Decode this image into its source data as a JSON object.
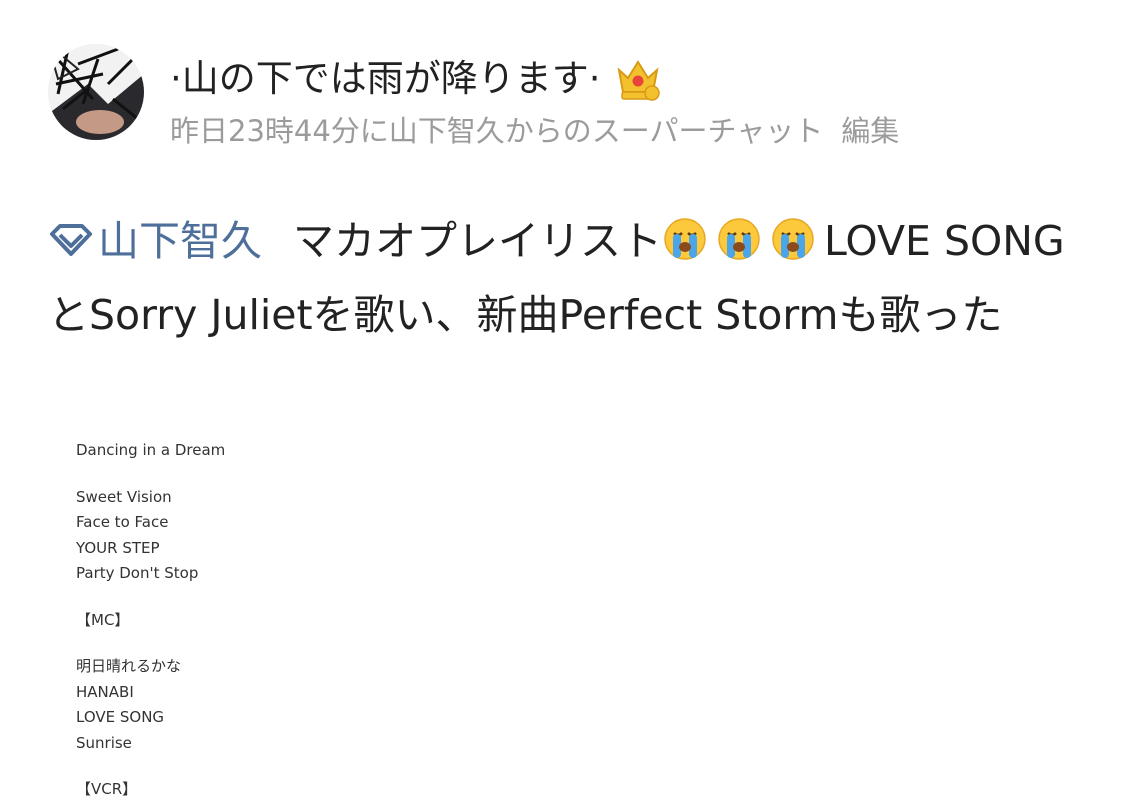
{
  "post": {
    "username": "·山の下では雨が降ります·",
    "meta_text": "昨日23時44分に山下智久からのスーパーチャット",
    "edit_label": "編集",
    "tag_label": "山下智久",
    "body_part1": "マカオプレイリスト",
    "body_part2": "LOVE SONGとSorry Julietを歌い、新曲Perfect Stormも歌った"
  },
  "icons": {
    "avatar": "avatar-image",
    "badge": "crown-icon",
    "tag": "diamond-tag-icon",
    "emoji": "loudly-crying-face-icon"
  },
  "colors": {
    "tag_link": "#4d6f99",
    "meta_gray": "#9b9b9b"
  },
  "setlist": {
    "partial_top": "Dancing in a Dream",
    "group1": [
      "Sweet Vision",
      "Face to Face",
      "YOUR STEP",
      "Party Don't Stop"
    ],
    "mc_label": "【MC】",
    "group2": [
      "明日晴れるかな",
      "HANABI",
      "LOVE SONG",
      "Sunrise"
    ],
    "partial_bottom": "【VCR】"
  }
}
